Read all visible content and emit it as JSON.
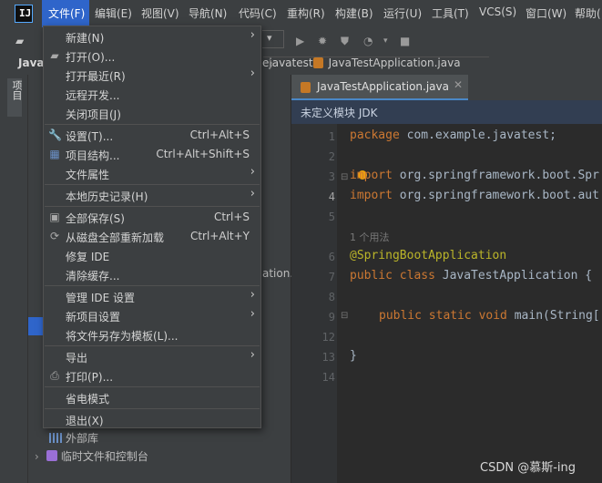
{
  "menubar": {
    "items": [
      "文件(F)",
      "编辑(E)",
      "视图(V)",
      "导航(N)",
      "代码(C)",
      "重构(R)",
      "构建(B)",
      "运行(U)",
      "工具(T)",
      "VCS(S)",
      "窗口(W)",
      "帮助("
    ]
  },
  "navbar": {
    "project_label": "Java",
    "crumb_prefix": "e",
    "crumb_package": "javatest",
    "crumb_file": "JavaTestApplication.java"
  },
  "left_strip": {
    "project_tab": "项目"
  },
  "project_panel": {
    "partial_text": "ation.j",
    "external_libs": "外部库",
    "scratches": "临时文件和控制台"
  },
  "editor": {
    "tab_label": "JavaTestApplication.java",
    "banner": "未定义模块 JDK",
    "usage_hint": "1 个用法",
    "line_numbers": [
      "1",
      "2",
      "3",
      "4",
      "5",
      "6",
      "7",
      "8",
      "9",
      "12",
      "13",
      "14"
    ],
    "lines": {
      "l1_kw": "package",
      "l1_rest": " com.example.javatest;",
      "l3_kw": "import",
      "l3_rest": " org.springframework.boot.Spr",
      "l4_kw": "import",
      "l4_rest": " org.springframework.boot.aut",
      "l6": "@SpringBootApplication",
      "l7_kw": "public class",
      "l7_rest": " JavaTestApplication {",
      "l9_kw": "public static void",
      "l9_rest": " main(String[",
      "l13": "}"
    }
  },
  "file_menu": {
    "items": [
      {
        "label": "新建(N)",
        "submenu": true
      },
      {
        "label": "打开(O)...",
        "icon": "folder-icon"
      },
      {
        "label": "打开最近(R)",
        "submenu": true
      },
      {
        "label": "远程开发..."
      },
      {
        "label": "关闭项目(J)"
      },
      {
        "label": "设置(T)...",
        "shortcut": "Ctrl+Alt+S",
        "icon": "wrench-icon"
      },
      {
        "label": "项目结构...",
        "shortcut": "Ctrl+Alt+Shift+S",
        "icon": "structure-icon"
      },
      {
        "label": "文件属性",
        "submenu": true
      },
      {
        "label": "本地历史记录(H)",
        "submenu": true
      },
      {
        "label": "全部保存(S)",
        "shortcut": "Ctrl+S",
        "icon": "save-icon"
      },
      {
        "label": "从磁盘全部重新加载",
        "shortcut": "Ctrl+Alt+Y",
        "icon": "reload-icon"
      },
      {
        "label": "修复 IDE"
      },
      {
        "label": "清除缓存..."
      },
      {
        "label": "管理 IDE 设置",
        "submenu": true
      },
      {
        "label": "新项目设置",
        "submenu": true
      },
      {
        "label": "将文件另存为模板(L)..."
      },
      {
        "label": "导出",
        "submenu": true
      },
      {
        "label": "打印(P)...",
        "icon": "print-icon"
      },
      {
        "label": "省电模式"
      },
      {
        "label": "退出(X)"
      }
    ]
  },
  "watermark": "CSDN @慕斯-ing",
  "colors": {
    "menu_highlight": "#2f65ca",
    "keyword": "#cc7832",
    "annotation": "#bbb529",
    "editor_bg": "#2b2b2b",
    "panel_bg": "#3c3f41"
  }
}
